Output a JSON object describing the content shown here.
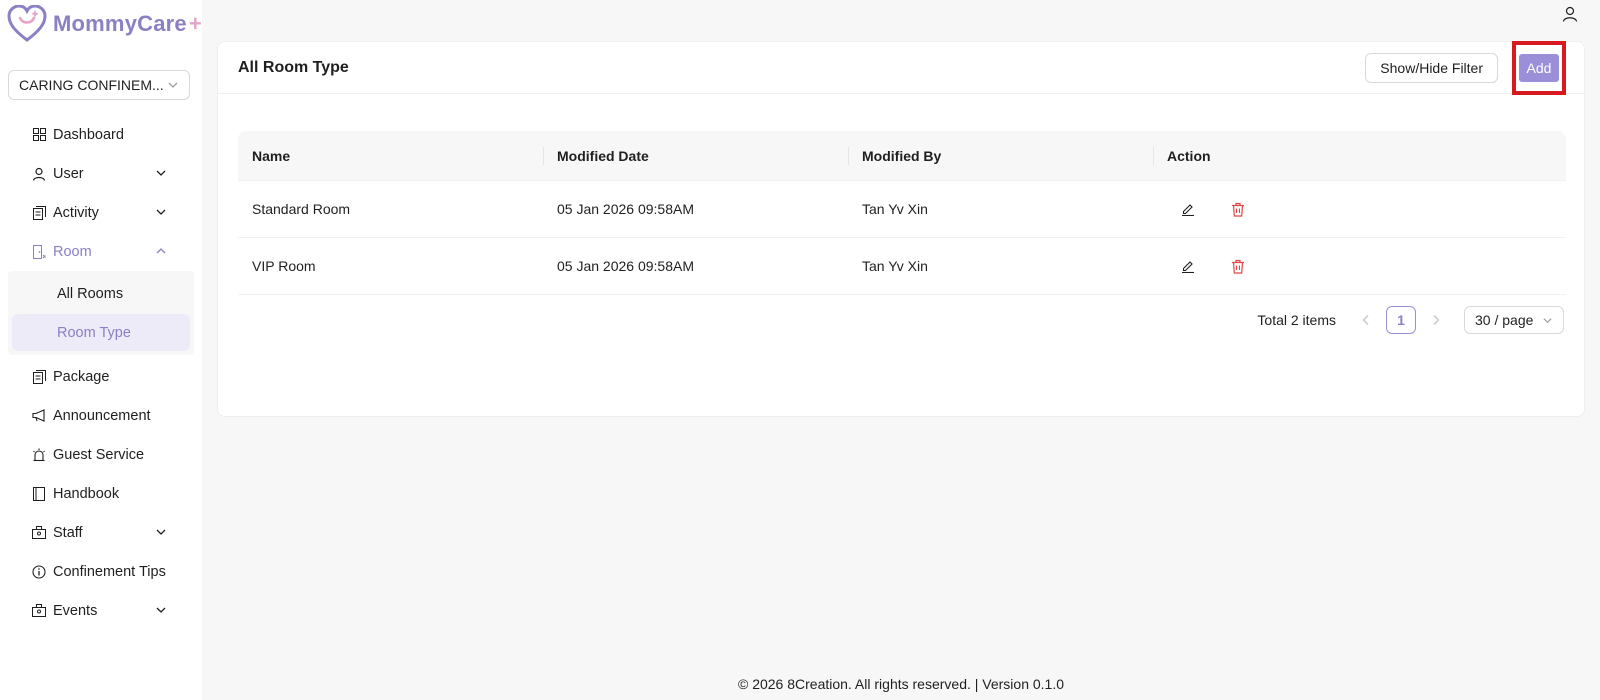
{
  "brand": {
    "name": "MommyCare",
    "plus": "+"
  },
  "org_select": {
    "value": "CARING CONFINEM..."
  },
  "nav": {
    "dashboard": "Dashboard",
    "user": "User",
    "activity": "Activity",
    "room": "Room",
    "room_sub": {
      "all_rooms": "All Rooms",
      "room_type": "Room Type"
    },
    "package": "Package",
    "announcement": "Announcement",
    "guest_service": "Guest Service",
    "handbook": "Handbook",
    "staff": "Staff",
    "confinement_tips": "Confinement Tips",
    "events": "Events"
  },
  "page": {
    "title": "All Room Type",
    "filter_button": "Show/Hide Filter",
    "add_button": "Add"
  },
  "table": {
    "columns": [
      "Name",
      "Modified Date",
      "Modified By",
      "Action"
    ],
    "rows": [
      {
        "name": "Standard Room",
        "modified_date": "05 Jan 2026 09:58AM",
        "modified_by": "Tan Yv Xin"
      },
      {
        "name": "VIP Room",
        "modified_date": "05 Jan 2026 09:58AM",
        "modified_by": "Tan Yv Xin"
      }
    ]
  },
  "pagination": {
    "total": "Total 2 items",
    "current_page": "1",
    "page_size": "30 / page"
  },
  "footer": "© 2026 8Creation. All rights reserved. | Version 0.1.0",
  "colors": {
    "accent": "#8c7fc4",
    "button": "#9a8fd8",
    "highlight": "#d71920",
    "delete": "#e04545"
  }
}
